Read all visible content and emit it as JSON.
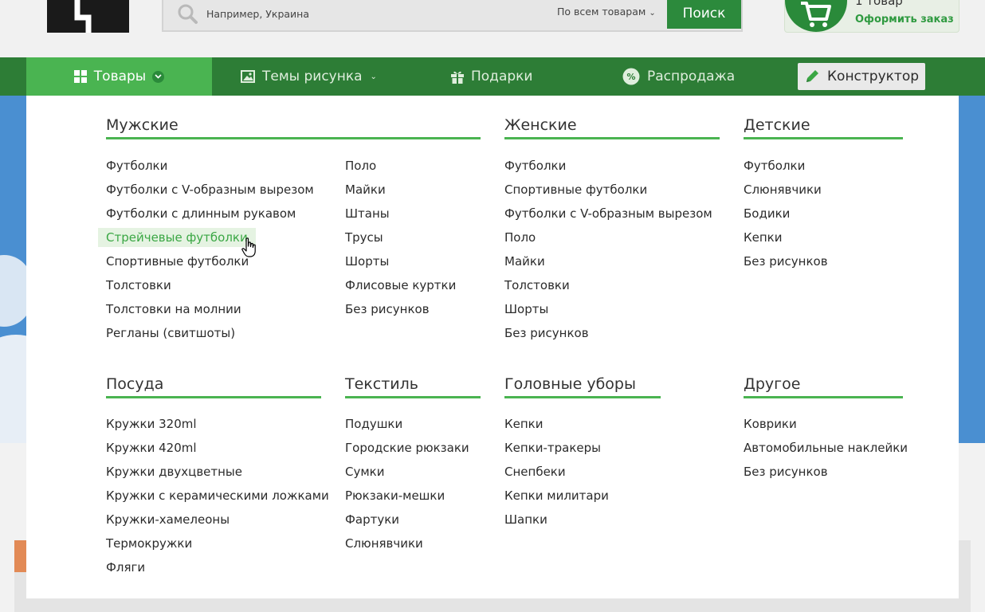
{
  "header": {
    "search": {
      "placeholder": "Например, Украина",
      "scope": "По всем товарам",
      "button": "Поиск"
    },
    "cart": {
      "count": "1 товар",
      "order_label": "Оформить заказ"
    }
  },
  "nav": {
    "products": "Товары",
    "themes": "Темы рисунка",
    "gifts": "Подарки",
    "sale": "Распродажа",
    "constructor": "Конструктор"
  },
  "menu": {
    "men": {
      "title": "Мужские",
      "col1": [
        "Футболки",
        "Футболки с V-образным вырезом",
        "Футболки с длинным рукавом",
        "Стрейчевые футболки",
        "Спортивные футболки",
        "Толстовки",
        "Толстовки на молнии",
        "Регланы (свитшоты)"
      ],
      "col2": [
        "Поло",
        "Майки",
        "Штаны",
        "Трусы",
        "Шорты",
        "Флисовые куртки",
        "Без рисунков"
      ]
    },
    "women": {
      "title": "Женские",
      "items": [
        "Футболки",
        "Спортивные футболки",
        "Футболки с V-образным вырезом",
        "Поло",
        "Майки",
        "Толстовки",
        "Шорты",
        "Без рисунков"
      ]
    },
    "kids": {
      "title": "Детские",
      "items": [
        "Футболки",
        "Слюнявчики",
        "Бодики",
        "Кепки",
        "Без рисунков"
      ]
    },
    "dishes": {
      "title": "Посуда",
      "items": [
        "Кружки 320ml",
        "Кружки 420ml",
        "Кружки двухцветные",
        "Кружки с керамическими ложками",
        "Кружки-хамелеоны",
        "Термокружки",
        "Фляги"
      ]
    },
    "textile": {
      "title": "Текстиль",
      "items": [
        "Подушки",
        "Городские рюкзаки",
        "Сумки",
        "Рюкзаки-мешки",
        "Фартуки",
        "Слюнявчики"
      ]
    },
    "headwear": {
      "title": "Головные уборы",
      "items": [
        "Кепки",
        "Кепки-тракеры",
        "Снепбеки",
        "Кепки милитари",
        "Шапки"
      ]
    },
    "other": {
      "title": "Другое",
      "items": [
        "Коврики",
        "Автомобильные наклейки",
        "Без рисунков"
      ]
    }
  },
  "colors": {
    "nav_bg": "#2d7d36",
    "accent": "#4ab451",
    "hover_bg": "#e5f3e2",
    "hover_text": "#3aa744"
  }
}
